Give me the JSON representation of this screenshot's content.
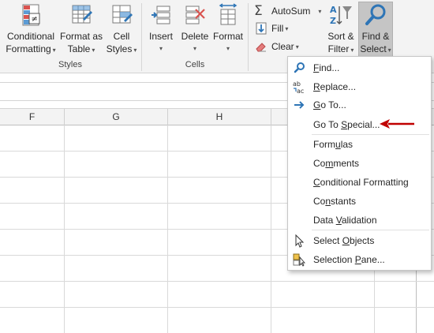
{
  "ribbon": {
    "styles_group": {
      "label": "Styles",
      "conditional_formatting": {
        "line1": "Conditional",
        "line2": "Formatting"
      },
      "format_as_table": {
        "line1": "Format as",
        "line2": "Table"
      },
      "cell_styles": {
        "line1": "Cell",
        "line2": "Styles"
      }
    },
    "cells_group": {
      "label": "Cells",
      "insert": "Insert",
      "delete": "Delete",
      "format": "Format"
    },
    "editing_group": {
      "autosum": "AutoSum",
      "fill": "Fill",
      "clear": "Clear",
      "sort_filter": {
        "line1": "Sort &",
        "line2": "Filter"
      },
      "find_select": {
        "line1": "Find &",
        "line2": "Select"
      }
    }
  },
  "grid": {
    "columns": [
      "F",
      "G",
      "H"
    ]
  },
  "menu": {
    "find": {
      "pre": "",
      "key": "F",
      "post": "ind..."
    },
    "replace": {
      "pre": "",
      "key": "R",
      "post": "eplace..."
    },
    "goto": {
      "pre": "",
      "key": "G",
      "post": "o To..."
    },
    "goto_special": {
      "pre": "Go To ",
      "key": "S",
      "post": "pecial..."
    },
    "formulas": {
      "pre": "Form",
      "key": "u",
      "post": "las"
    },
    "comments": {
      "pre": "Co",
      "key": "m",
      "post": "ments"
    },
    "conditional_formatting": {
      "pre": "",
      "key": "C",
      "post": "onditional Formatting"
    },
    "constants": {
      "pre": "Co",
      "key": "n",
      "post": "stants"
    },
    "data_validation": {
      "pre": "Data ",
      "key": "V",
      "post": "alidation"
    },
    "select_objects": {
      "pre": "Select ",
      "key": "O",
      "post": "bjects"
    },
    "selection_pane": {
      "pre": "Selection ",
      "key": "P",
      "post": "ane..."
    }
  },
  "colors": {
    "ribbon_bg": "#f3f3f3",
    "accent_blue": "#2e75b6",
    "annotation_red": "#c00000",
    "selected_button_bg": "#c5c5c5"
  },
  "icons": [
    "conditional-formatting-icon",
    "format-as-table-icon",
    "cell-styles-icon",
    "insert-cells-icon",
    "delete-cells-icon",
    "format-cells-icon",
    "autosum-icon",
    "fill-icon",
    "clear-icon",
    "sort-filter-icon",
    "find-select-icon",
    "find-icon",
    "replace-icon",
    "goto-icon",
    "select-objects-icon",
    "selection-pane-icon"
  ]
}
